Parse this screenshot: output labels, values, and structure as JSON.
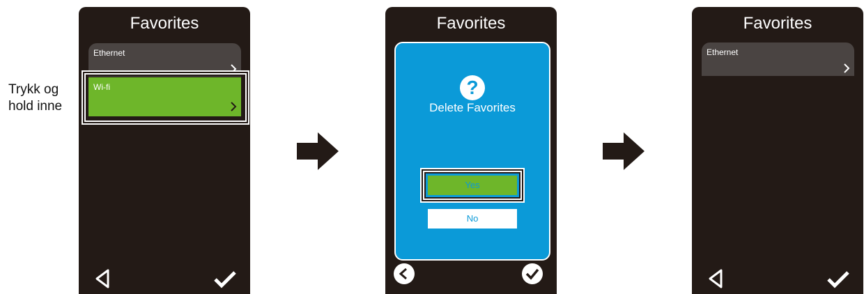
{
  "instruction": {
    "line1": "Trykk og",
    "line2": "hold inne"
  },
  "panel1": {
    "title": "Favorites",
    "items": [
      {
        "label": "Ethernet"
      },
      {
        "label": "Wi-fi"
      }
    ]
  },
  "panel2": {
    "title": "Favorites",
    "dialog": {
      "title": "Delete Favorites",
      "yes": "Yes",
      "no": "No",
      "icon": "?"
    }
  },
  "panel3": {
    "title": "Favorites",
    "items": [
      {
        "label": "Ethernet"
      }
    ]
  },
  "colors": {
    "screen": "#231a16",
    "accent_green": "#6eb62a",
    "dialog_blue": "#0b9ad8",
    "item_gray": "#4a4442"
  }
}
